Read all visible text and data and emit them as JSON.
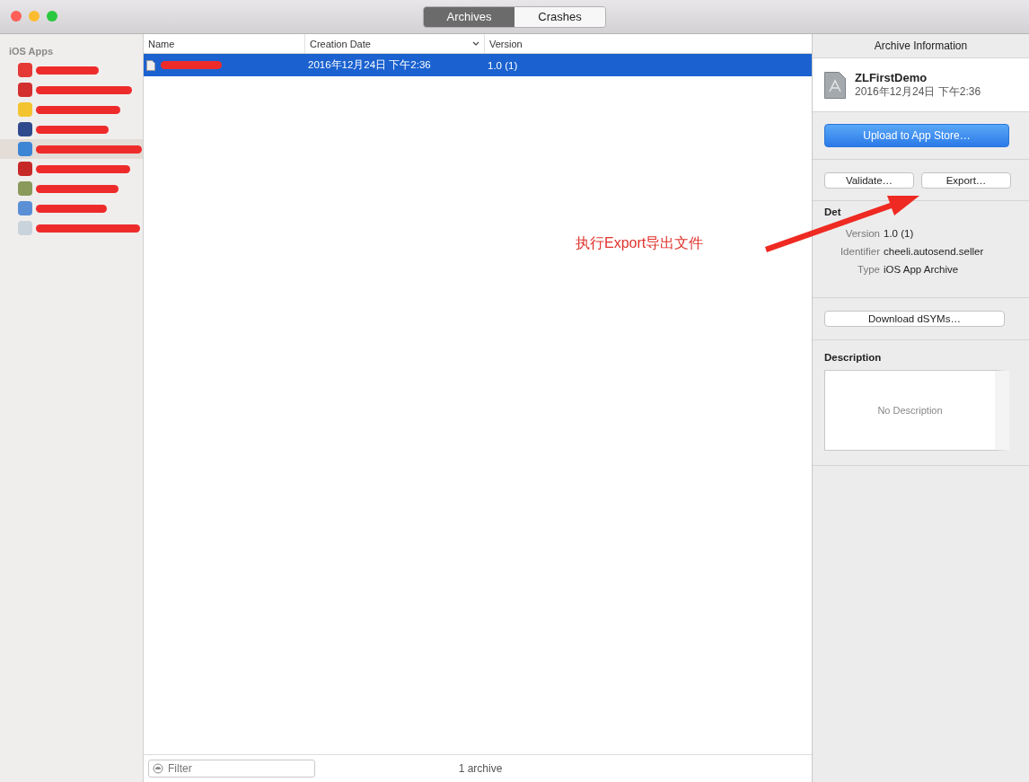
{
  "tabs": [
    {
      "label": "Archives",
      "selected": true
    },
    {
      "label": "Crashes",
      "selected": false
    }
  ],
  "sidebar": {
    "section": "iOS Apps",
    "items": [
      {
        "color": "#e53935",
        "selected": false
      },
      {
        "color": "#d32f2f",
        "selected": false
      },
      {
        "color": "#f4c430",
        "selected": false
      },
      {
        "color": "#2e4a8c",
        "selected": false
      },
      {
        "color": "#3d86d6",
        "selected": true
      },
      {
        "color": "#c62828",
        "selected": false
      },
      {
        "color": "#8a9a5b",
        "selected": false
      },
      {
        "color": "#5b8fd6",
        "selected": false
      },
      {
        "color": "#c9d3dc",
        "selected": false
      }
    ]
  },
  "table": {
    "columns": [
      {
        "label": "Name",
        "sorted": false
      },
      {
        "label": "Creation Date",
        "sorted": true
      },
      {
        "label": "Version",
        "sorted": false
      }
    ],
    "rows": [
      {
        "selected": true,
        "creation_date": "2016年12月24日 下午2:36",
        "version": "1.0 (1)"
      }
    ],
    "filter": {
      "placeholder": "Filter"
    },
    "count": "1 archive"
  },
  "info": {
    "title": "Archive Information",
    "archive_name": "ZLFirstDemo",
    "archive_date": "2016年12月24日 下午2:36",
    "upload_button": "Upload to App Store…",
    "validate_button": "Validate…",
    "export_button": "Export…",
    "details_heading": "Det",
    "details": [
      {
        "label": "Version",
        "value": "1.0 (1)"
      },
      {
        "label": "Identifier",
        "value": "cheeli.autosend.seller"
      },
      {
        "label": "Type",
        "value": "iOS App Archive"
      }
    ],
    "download_button": "Download dSYMs…",
    "description_heading": "Description",
    "description_placeholder": "No Description"
  },
  "annotation": {
    "text": "执行Export导出文件"
  }
}
